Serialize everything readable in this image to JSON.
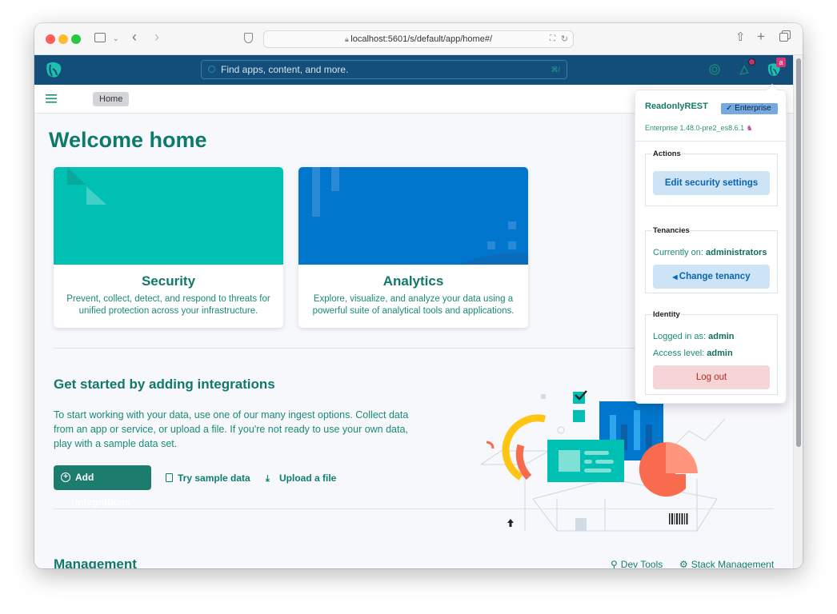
{
  "browser": {
    "url": "localhost:5601/s/default/app/home#/",
    "traffic_lights": {
      "close": "#ff5f57",
      "minimize": "#febc2e",
      "maximize": "#28c840"
    }
  },
  "header": {
    "search_placeholder": "Find apps, content, and more.",
    "search_shortcut": "⌘/",
    "user_badge": "a"
  },
  "breadcrumb": {
    "home": "Home"
  },
  "page": {
    "title": "Welcome home",
    "cards": [
      {
        "title": "Security",
        "description": "Prevent, collect, detect, and respond to threats for unified protection across your infrastructure.",
        "color": "#00bfb3"
      },
      {
        "title": "Analytics",
        "description": "Explore, visualize, and analyze your data using a powerful suite of analytical tools and applications.",
        "color": "#0077cc"
      }
    ],
    "integrations": {
      "title": "Get started by adding integrations",
      "text": "To start working with your data, use one of our many ingest options. Collect data from an app or service, or upload a file. If you're not ready to use your own data, play with a sample data set.",
      "add_button": "Add integrations",
      "sample_button": "Try sample data",
      "upload_button": "Upload a file"
    },
    "management": {
      "title": "Management",
      "dev_tools": "Dev Tools",
      "stack_management": "Stack Management"
    }
  },
  "popover": {
    "brand": "ReadonlyREST",
    "badge": "Enterprise",
    "version": "Enterprise 1.48.0-pre2_es8.6.1",
    "actions": {
      "legend": "Actions",
      "edit_button": "Edit security settings"
    },
    "tenancies": {
      "legend": "Tenancies",
      "current_label": "Currently on:",
      "current_value": "administrators",
      "change_button": "Change tenancy"
    },
    "identity": {
      "legend": "Identity",
      "logged_label": "Logged in as:",
      "logged_value": "admin",
      "access_label": "Access level:",
      "access_value": "admin",
      "logout_button": "Log out"
    }
  }
}
